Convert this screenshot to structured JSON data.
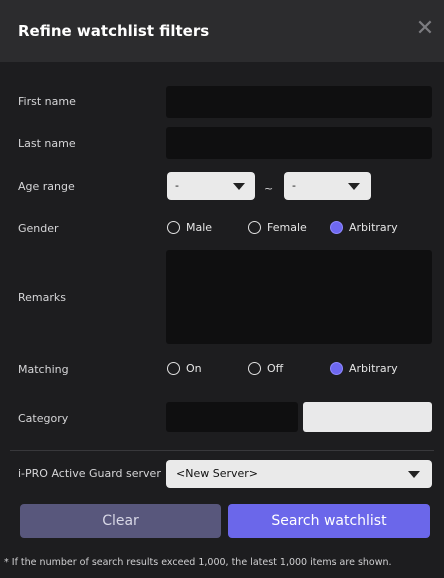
{
  "dialog": {
    "title": "Refine watchlist filters",
    "close_icon": "close-icon"
  },
  "fields": {
    "first_name_label": "First name",
    "first_name_value": "",
    "last_name_label": "Last name",
    "last_name_value": "",
    "age_range_label": "Age range",
    "age_from_value": "-",
    "age_separator": "~",
    "age_to_value": "-",
    "gender_label": "Gender",
    "gender_options": [
      "Male",
      "Female",
      "Arbitrary"
    ],
    "gender_selected": "Arbitrary",
    "remarks_label": "Remarks",
    "remarks_value": "",
    "matching_label": "Matching",
    "matching_options": [
      "On",
      "Off",
      "Arbitrary"
    ],
    "matching_selected": "Arbitrary",
    "category_label": "Category",
    "server_label": "i-PRO Active Guard server",
    "server_value": "<New Server>"
  },
  "buttons": {
    "clear": "Clear",
    "search": "Search watchlist"
  },
  "footer_note": "* If the number of search results exceed 1,000, the latest 1,000 items are shown.",
  "colors": {
    "accent": "#6b67ea",
    "secondary_button": "#58577c",
    "background": "#1d1d1f"
  }
}
